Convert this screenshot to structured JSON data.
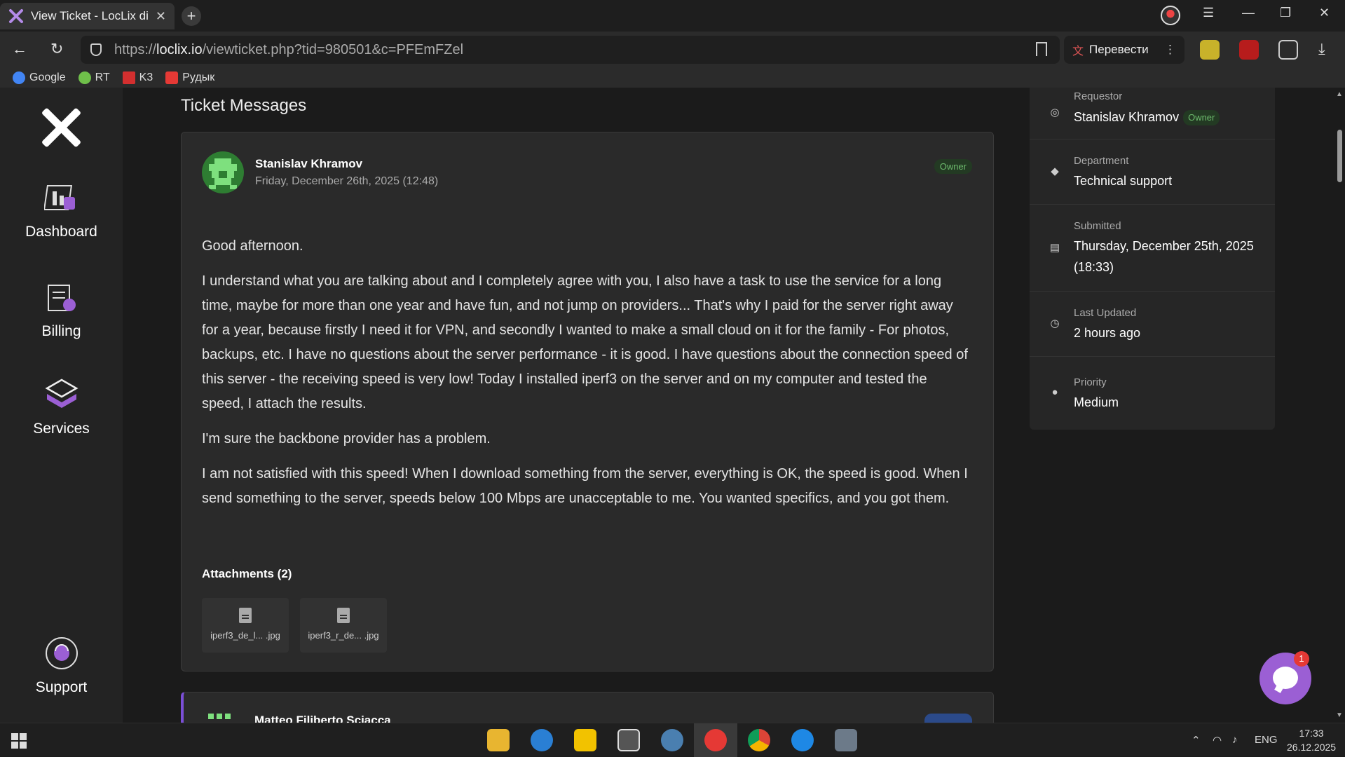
{
  "browser": {
    "tab_title": "View Ticket - LocLix di S",
    "new_tab": "+",
    "url_prefix": "https://",
    "url_domain": "loclix.io",
    "url_path": "/viewticket.php?tid=980501&c=PFEmFZel",
    "translate_label": "Перевести",
    "bookmarks": [
      {
        "label": "Google",
        "color": "#4285f4"
      },
      {
        "label": "RT",
        "color": "#6fbf4a"
      },
      {
        "label": "K3",
        "color": "#d32f2f"
      },
      {
        "label": "Рудык",
        "color": "#e53935"
      }
    ]
  },
  "sidebar": {
    "items": [
      {
        "label": "Dashboard",
        "icon": "dashboard-icon"
      },
      {
        "label": "Billing",
        "icon": "billing-icon"
      },
      {
        "label": "Services",
        "icon": "services-icon"
      },
      {
        "label": "Support",
        "icon": "support-icon"
      }
    ]
  },
  "main": {
    "section_title": "Ticket Messages",
    "message": {
      "author": "Stanislav Khramov",
      "date": "Friday, December 26th, 2025 (12:48)",
      "badge": "Owner",
      "paragraphs": [
        "Good afternoon.",
        "I understand what you are talking about and I completely agree with you, I also have a task to use the service for a long time, maybe for more than one year and have fun, and not jump on providers... That's why I paid for the server right away for a year, because firstly I need it for VPN, and secondly I wanted to make a small cloud on it for the family - For photos, backups, etc. I have no questions about the server performance - it is good. I have questions about the connection speed of this server - the receiving speed is very low! Today I installed iperf3 on the server and on my computer and tested the speed, I attach the results.",
        "I'm sure the backbone provider has a problem.",
        "I am not satisfied with this speed! When I download something from the server, everything is OK, the speed is good. When I send something to the server, speeds below 100 Mbps are unacceptable to me. You wanted specifics, and you got them."
      ],
      "attachments_title": "Attachments (2)",
      "attachments": [
        {
          "name": "iperf3_de_l... .jpg"
        },
        {
          "name": "iperf3_r_de... .jpg"
        }
      ]
    },
    "message2": {
      "author": "Matteo Filiberto Sciacca"
    }
  },
  "info": {
    "requestor_label": "Requestor",
    "requestor_value": "Stanislav Khramov",
    "requestor_badge": "Owner",
    "department_label": "Department",
    "department_value": "Technical support",
    "submitted_label": "Submitted",
    "submitted_value": "Thursday, December 25th, 2025 (18:33)",
    "updated_label": "Last Updated",
    "updated_value": "2 hours ago",
    "priority_label": "Priority",
    "priority_value": "Medium"
  },
  "chat": {
    "badge_count": "1"
  },
  "taskbar": {
    "lang": "ENG",
    "time": "17:33",
    "date": "26.12.2025"
  }
}
